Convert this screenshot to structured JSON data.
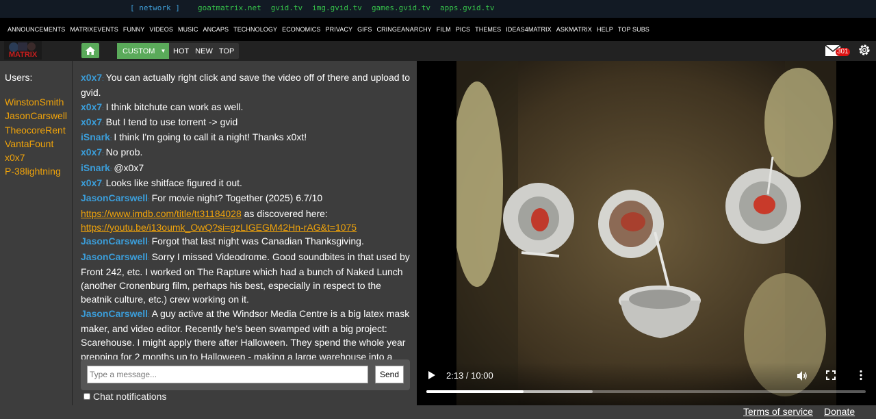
{
  "network": {
    "label": "[ network ]",
    "links": [
      "goatmatrix.net",
      "gvid.tv",
      "img.gvid.tv",
      "games.gvid.tv",
      "apps.gvid.tv"
    ]
  },
  "subnav": [
    "ANNOUNCEMENTS",
    "MATRIXEVENTS",
    "FUNNY",
    "VIDEOS",
    "MUSIC",
    "ANCAPS",
    "TECHNOLOGY",
    "ECONOMICS",
    "PRIVACY",
    "GIFS",
    "CRINGEANARCHY",
    "FILM",
    "PICS",
    "THEMES",
    "IDEAS4MATRIX",
    "ASKMATRIX",
    "HELP",
    "TOP SUBS"
  ],
  "header": {
    "logo_text": "MATRIX",
    "sort_custom": "CUSTOM",
    "sort_tabs": [
      "HOT",
      "NEW",
      "TOP"
    ],
    "mail_count": "301"
  },
  "users": {
    "title": "Users:",
    "list": [
      "WinstonSmith",
      "JasonCarswell",
      "TheocoreRent",
      "VantaFount",
      "x0x7",
      "P-38lightning"
    ]
  },
  "chat": {
    "messages": [
      {
        "nick": "x0x7",
        "parts": [
          {
            "t": "You can actually right click and save the video off of there and upload to gvid."
          }
        ]
      },
      {
        "nick": "x0x7",
        "parts": [
          {
            "t": "I think bitchute can work as well."
          }
        ]
      },
      {
        "nick": "x0x7",
        "parts": [
          {
            "t": "But I tend to use torrent -> gvid"
          }
        ]
      },
      {
        "nick": "iSnark",
        "parts": [
          {
            "t": "I think I'm going to call it a night! Thanks x0xt!"
          }
        ]
      },
      {
        "nick": "x0x7",
        "parts": [
          {
            "t": "No prob."
          }
        ]
      },
      {
        "nick": "iSnark",
        "parts": [
          {
            "t": "@x0x7"
          }
        ]
      },
      {
        "nick": "x0x7",
        "parts": [
          {
            "t": "Looks like shitface figured it out."
          }
        ]
      },
      {
        "nick": "JasonCarswell",
        "parts": [
          {
            "t": "For movie night? Together (2025) 6.7/10 "
          },
          {
            "l": "https://www.imdb.com/title/tt31184028"
          },
          {
            "t": " as discovered here: "
          },
          {
            "l": "https://youtu.be/i13oumk_OwQ?si=gzLIGEGM42Hn-rAG&t=1075"
          }
        ]
      },
      {
        "nick": "JasonCarswell",
        "parts": [
          {
            "t": "Forgot that last night was Canadian Thanksgiving."
          }
        ]
      },
      {
        "nick": "JasonCarswell",
        "parts": [
          {
            "t": "Sorry I missed Videodrome. Good soundbites in that used by Front 242, etc. I worked on The Rapture which had a bunch of Naked Lunch (another Cronenburg film, perhaps his best, especially in respect to the beatnik culture, etc.) crew working on it."
          }
        ]
      },
      {
        "nick": "JasonCarswell",
        "parts": [
          {
            "t": "A guy active at the Windsor Media Centre is a big latex mask maker, and video editor. Recently he's been swamped with a big project: Scarehouse. I might apply there after Halloween. They spend the whole year prepping for 2 months up to Halloween - making a large warehouse into a haunted fun house thing. Haven't ever been. Haven't seen the Windsor-based"
          }
        ]
      }
    ],
    "input_placeholder": "Type a message...",
    "send_label": "Send",
    "notif_label": "Chat notifications"
  },
  "video": {
    "time_label": "2:13 / 10:00",
    "played_fraction": 0.2217,
    "buffered_fraction": 0.378
  },
  "footer": {
    "terms": "Terms of service",
    "donate": "Donate"
  },
  "colors": {
    "accent_green": "#5aaa5a",
    "nick_blue": "#3b9dd9",
    "user_orange": "#f0a30a",
    "link_orange": "#f0a30a"
  }
}
